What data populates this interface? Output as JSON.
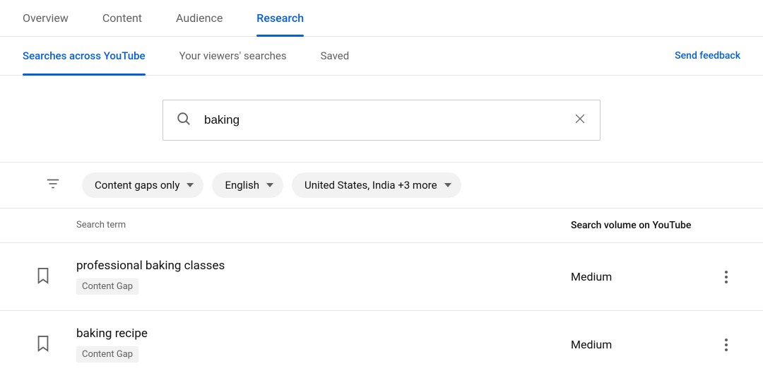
{
  "top_tabs": {
    "overview": "Overview",
    "content": "Content",
    "audience": "Audience",
    "research": "Research"
  },
  "sub_tabs": {
    "searches": "Searches across YouTube",
    "viewers": "Your viewers' searches",
    "saved": "Saved"
  },
  "send_feedback": "Send feedback",
  "search": {
    "value": "baking",
    "placeholder": ""
  },
  "filters": {
    "chip0": "Content gaps only",
    "chip1": "English",
    "chip2": "United States, India +3 more"
  },
  "headers": {
    "term": "Search term",
    "volume": "Search volume on YouTube"
  },
  "results": {
    "0": {
      "term": "professional baking classes",
      "badge": "Content Gap",
      "volume": "Medium"
    },
    "1": {
      "term": "baking recipe",
      "badge": "Content Gap",
      "volume": "Medium"
    }
  }
}
